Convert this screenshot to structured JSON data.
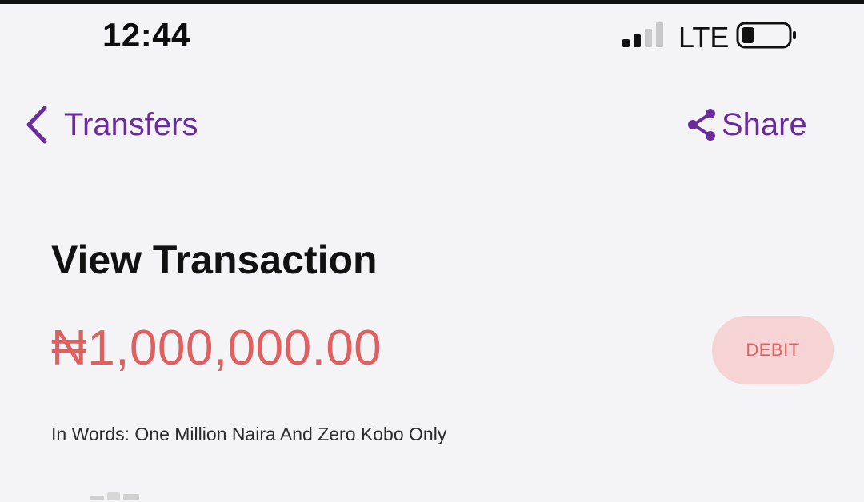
{
  "status_bar": {
    "time": "12:44",
    "network": "LTE",
    "signal_bars_active": 2,
    "signal_bars_total": 4,
    "battery_level": 0.25
  },
  "nav": {
    "back_label": "Transfers",
    "back_icon": "chevron-left-icon",
    "share_label": "Share",
    "share_icon": "share-icon"
  },
  "transaction": {
    "title": "View Transaction",
    "amount": "₦1,000,000.00",
    "type_badge": "DEBIT",
    "amount_in_words": "In Words: One Million Naira And Zero Kobo Only"
  },
  "colors": {
    "accent": "#6a2c9a",
    "debit": "#e06060",
    "debit_badge_bg": "#f6d4d5",
    "background": "#f4f3f5"
  }
}
